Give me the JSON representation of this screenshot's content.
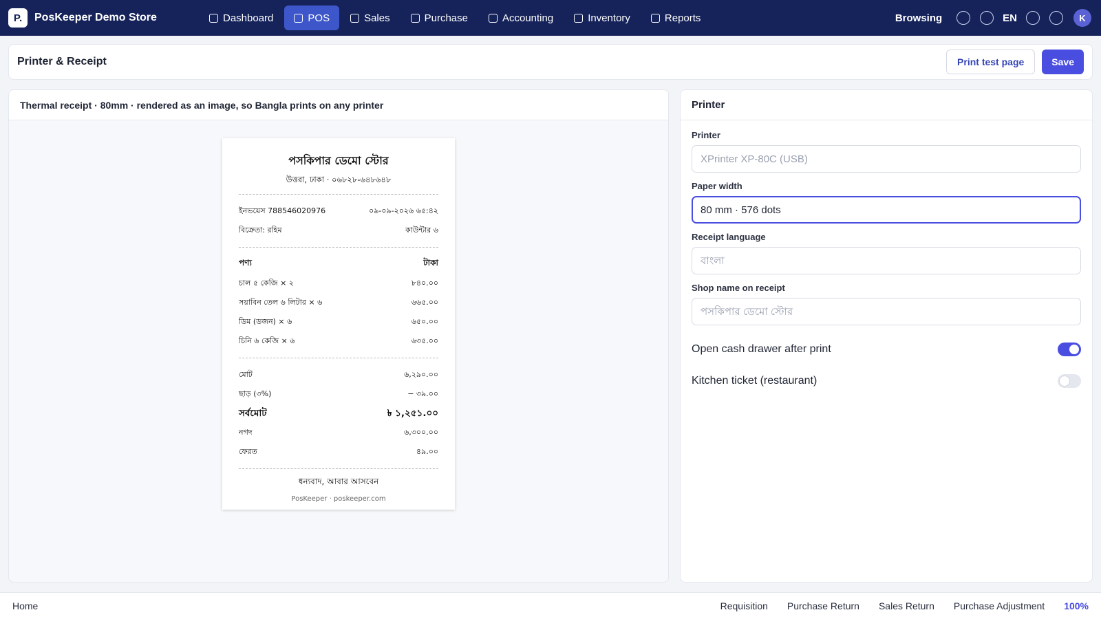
{
  "app": {
    "logo_text": "P.",
    "store_name": "PosKeeper Demo Store"
  },
  "nav": {
    "items": [
      {
        "label": "Dashboard",
        "active": false
      },
      {
        "label": "POS",
        "active": true
      },
      {
        "label": "Sales",
        "active": false
      },
      {
        "label": "Purchase",
        "active": false
      },
      {
        "label": "Accounting",
        "active": false
      },
      {
        "label": "Inventory",
        "active": false
      },
      {
        "label": "Reports",
        "active": false
      }
    ]
  },
  "topright": {
    "browsing_label": "Browsing",
    "language": "EN",
    "avatar_initial": "K"
  },
  "header": {
    "title": "Printer & Receipt",
    "print_test_label": "Print test page",
    "save_label": "Save"
  },
  "preview": {
    "caption": "Thermal receipt · 80mm · rendered as an image, so Bangla prints on any printer",
    "receipt": {
      "shop_name": "পসকিপার ডেমো স্টোর",
      "address": "উত্তরা, ঢাকা · ০৬৮২৮-৬৪৮৬৪৮",
      "invoice": "ইনভয়েস 788546020976",
      "datetime": "০৯-০৯-২০২৬ ৬৫:৪২",
      "seller": "বিক্রেতা: রহিম",
      "counter": "কাউন্টার ৬",
      "col_item": "পণ্য",
      "col_amount": "টাকা",
      "items": [
        {
          "name": "চাল ৫ কেজি × ২",
          "amount": "৮৪০.০০"
        },
        {
          "name": "সয়াবিন তেল ৬ লিটার × ৬",
          "amount": "৬৬৫.০০"
        },
        {
          "name": "ডিম (ডজন) × ৬",
          "amount": "৬৫০.০০"
        },
        {
          "name": "চিনি ৬ কেজি × ৬",
          "amount": "৬৩৫.০০"
        }
      ],
      "subtotal_label": "মোট",
      "subtotal": "৬,২৯০.০০",
      "discount_label": "ছাড় (৩%)",
      "discount": "− ৩৯.০০",
      "grand_label": "সর্বমোট",
      "grand_total": "৳ ১,২৫১.০০",
      "cash_label": "নগদ",
      "cash": "৬,৩০০.০০",
      "change_label": "ফেরত",
      "change": "৪৯.০০",
      "thanks": "ধন্যবাদ, আবার আসবেন",
      "footer": "PosKeeper · poskeeper.com"
    }
  },
  "settings": {
    "title": "Printer",
    "printer_label": "Printer",
    "printer_placeholder": "XPrinter XP-80C (USB)",
    "paper_width_label": "Paper width",
    "paper_width_value": "80 mm · 576 dots",
    "language_label": "Receipt language",
    "language_placeholder": "বাংলা",
    "shop_name_label": "Shop name on receipt",
    "shop_name_placeholder": "পসকিপার ডেমো স্টোর",
    "cash_drawer_label": "Open cash drawer after print",
    "cash_drawer_on": true,
    "kitchen_ticket_label": "Kitchen ticket (restaurant)",
    "kitchen_ticket_on": false
  },
  "bottom": {
    "home": "Home",
    "links": [
      "Requisition",
      "Purchase Return",
      "Sales Return",
      "Purchase Adjustment"
    ],
    "zoom": "100%"
  },
  "colors": {
    "topbar": "#16235a",
    "nav_active": "#3d56c9",
    "accent": "#4a4ee0"
  }
}
